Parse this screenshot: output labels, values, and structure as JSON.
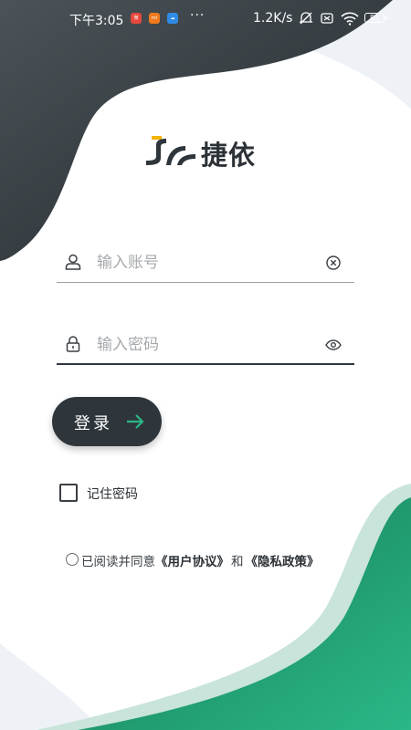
{
  "status_bar": {
    "time": "下午3:05",
    "notifications": [
      "weibo-icon",
      "mi-icon",
      "cloud-icon"
    ],
    "more": "···",
    "network_speed": "1.2K/s",
    "battery": "83"
  },
  "brand": {
    "name": "捷依",
    "colors": {
      "primary": "#2e363b",
      "accent": "#f2b400",
      "green": "#1f8a5e"
    }
  },
  "form": {
    "account_placeholder": "输入账号",
    "password_placeholder": "输入密码",
    "login_label": "登录",
    "remember_label": "记住密码",
    "remember_checked": false
  },
  "agreement": {
    "prefix": "已阅读并同意",
    "user_agreement": "《用户协议》",
    "conjunction": "和",
    "privacy_policy": "《隐私政策》",
    "agreed": false
  },
  "icons": {
    "account": "user-icon",
    "password": "lock-icon",
    "clear": "clear-icon",
    "visibility": "eye-icon",
    "login_arrow": "arrow-right-icon"
  }
}
